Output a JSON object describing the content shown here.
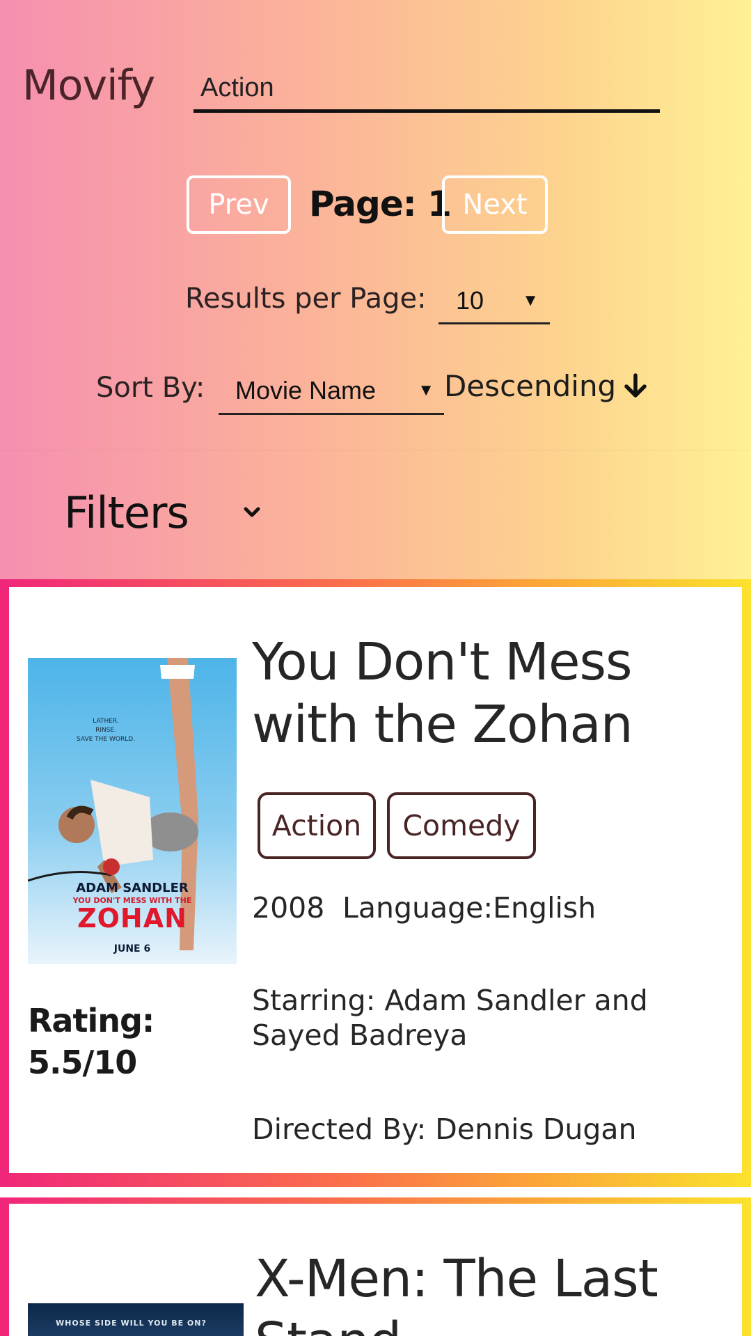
{
  "app": {
    "brand": "Movify"
  },
  "search": {
    "value": "Action"
  },
  "pagination": {
    "prev_label": "Prev",
    "next_label": "Next",
    "page_label": "Page: 1",
    "page": 1
  },
  "results_per_page": {
    "label": "Results per Page:",
    "value": "10"
  },
  "sort": {
    "label": "Sort By:",
    "value": "Movie Name",
    "direction_label": "Descending"
  },
  "filters": {
    "label": "Filters"
  },
  "icons": {
    "dropdown": "caret-down-icon",
    "sort_direction": "arrow-down-icon",
    "filters_toggle": "chevron-down-icon"
  },
  "colors": {
    "chip_border": "#4a2424",
    "card_border_start": "#f0267a",
    "card_border_end": "#fbe22d"
  },
  "movies": [
    {
      "title": "You Don't Mess with the Zohan",
      "genres": [
        "Action",
        "Comedy"
      ],
      "year": "2008",
      "language": "Language:English",
      "starring": "Starring: Adam Sandler and Sayed Badreya",
      "director": "Directed By: Dennis Dugan",
      "rating_label": "Rating:",
      "rating_value": "5.5/10",
      "poster": {
        "tagline_1": "LATHER.",
        "tagline_2": "RINSE.",
        "tagline_3": "SAVE THE WORLD.",
        "actor": "ADAM SANDLER",
        "subtitle": "YOU DON'T MESS WITH THE",
        "title": "ZOHAN",
        "date": "JUNE 6"
      }
    },
    {
      "title": "X-Men: The Last Stand",
      "poster": {
        "tagline": "WHOSE SIDE WILL YOU BE ON?"
      }
    }
  ]
}
